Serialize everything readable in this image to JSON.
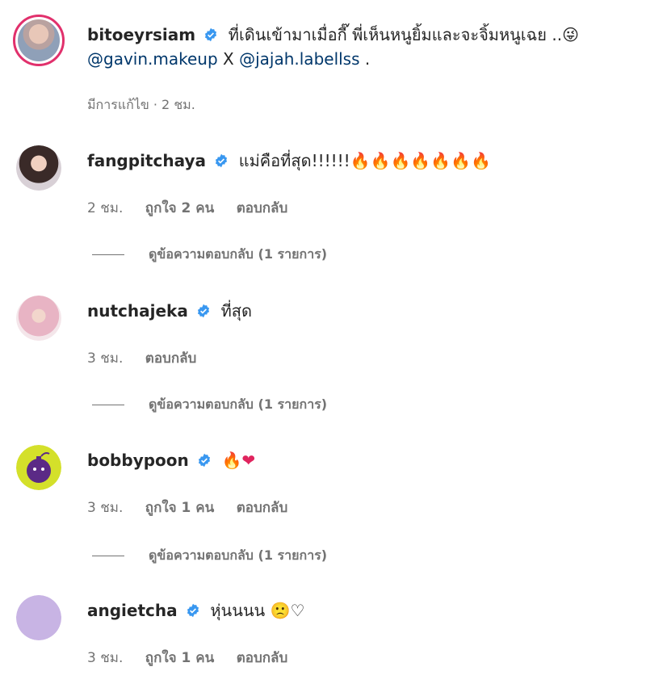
{
  "caption": {
    "username": "bitoeyrsiam",
    "text": "ที่เดินเข้ามาเมื่อกี๊ พี่เห็นหนูยิ้มและจะจิ้มหนูเฉย ..😜",
    "mention1": "@gavin.makeup",
    "x": "X",
    "mention2": "@jajah.labellss",
    "dot": ".",
    "meta": "มีการแก้ไข · 2 ชม."
  },
  "comments": [
    {
      "username": "fangpitchaya",
      "text": "แม่คือที่สุด!!!!!!",
      "emoji": "🔥🔥🔥🔥🔥🔥🔥",
      "time": "2 ชม.",
      "likes": "ถูกใจ 2 คน",
      "reply": "ตอบกลับ",
      "view_replies": "ดูข้อความตอบกลับ (1 รายการ)"
    },
    {
      "username": "nutchajeka",
      "text": "ที่สุด",
      "emoji": "",
      "time": "3 ชม.",
      "reply": "ตอบกลับ",
      "view_replies": "ดูข้อความตอบกลับ (1 รายการ)"
    },
    {
      "username": "bobbypoon",
      "text": "",
      "emoji": "🔥❤",
      "time": "3 ชม.",
      "likes": "ถูกใจ 1 คน",
      "reply": "ตอบกลับ",
      "view_replies": "ดูข้อความตอบกลับ (1 รายการ)"
    },
    {
      "username": "angietcha",
      "text": "หุ่นนนน",
      "emoji": "🙁♡",
      "time": "3 ชม.",
      "likes": "ถูกใจ 1 คน",
      "reply": "ตอบกลับ"
    }
  ],
  "colors": {
    "verified": "#3897f0",
    "mention": "#00376b",
    "meta": "#737373",
    "ring": "#e1306c"
  },
  "icons": {
    "verified": "verified-badge-icon"
  }
}
